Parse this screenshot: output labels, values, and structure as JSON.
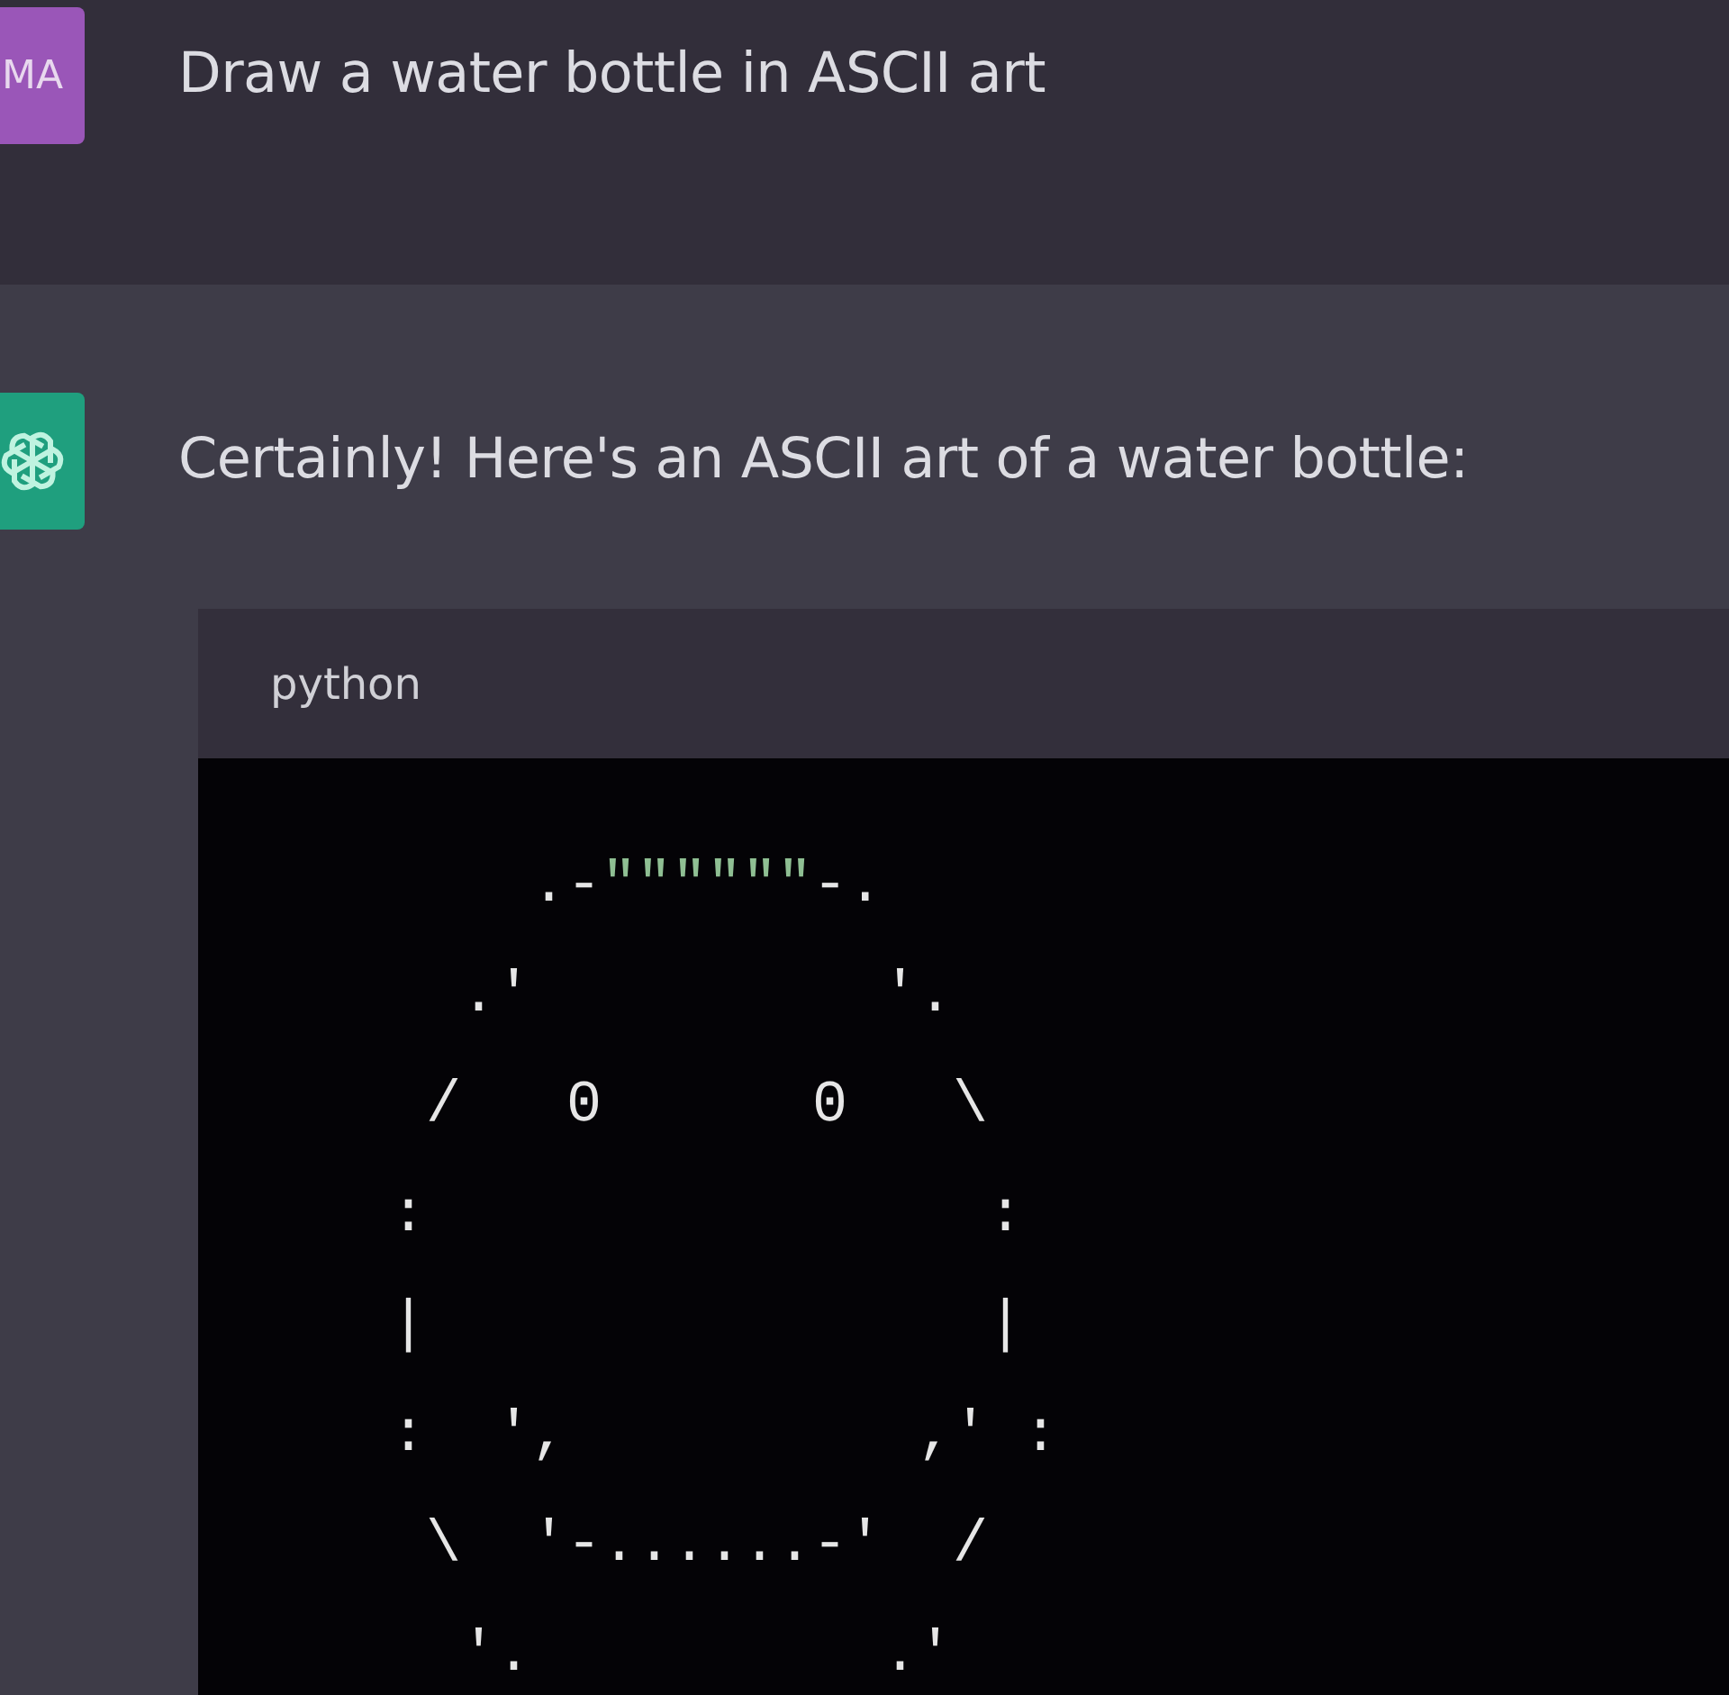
{
  "messages": [
    {
      "kind": "user",
      "avatar": "MA",
      "text": "Draw a water bottle in ASCII art"
    },
    {
      "kind": "assistant",
      "text": "Certainly! Here's an ASCII art of a water bottle:",
      "code": {
        "language": "python",
        "lines": [
          [
            {
              "kind": "plain",
              "text": "    .-"
            },
            {
              "kind": "string",
              "text": "\"\"\"\"\"\""
            },
            {
              "kind": "plain",
              "text": "-."
            }
          ],
          [
            {
              "kind": "plain",
              "text": "  .'          '."
            }
          ],
          [
            {
              "kind": "plain",
              "text": " /   0      0   \\"
            }
          ],
          [
            {
              "kind": "plain",
              "text": ":                :"
            }
          ],
          [
            {
              "kind": "plain",
              "text": "|                |"
            }
          ],
          [
            {
              "kind": "plain",
              "text": ":  ',          ,' :"
            }
          ],
          [
            {
              "kind": "plain",
              "text": " \\  '-......-'  /"
            }
          ],
          [
            {
              "kind": "plain",
              "text": "  '.          .'"
            }
          ]
        ]
      }
    }
  ]
}
